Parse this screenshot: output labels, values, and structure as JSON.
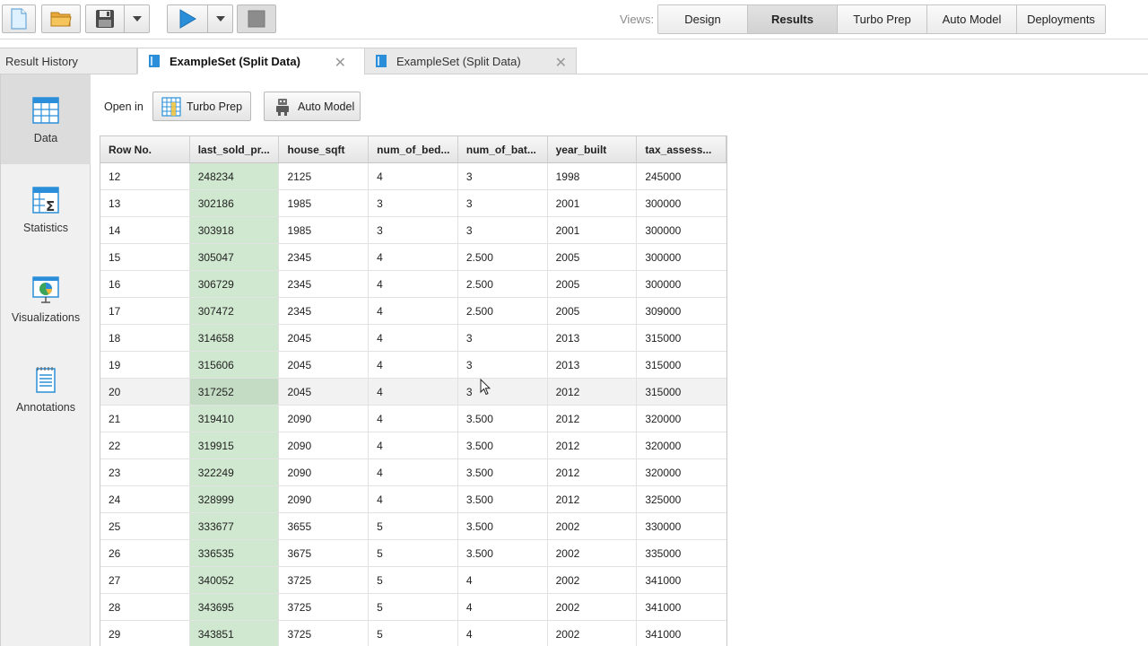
{
  "toolbar": {
    "views_label": "Views:",
    "views": [
      {
        "label": "Design",
        "active": false
      },
      {
        "label": "Results",
        "active": true
      },
      {
        "label": "Turbo Prep",
        "active": false
      },
      {
        "label": "Auto Model",
        "active": false
      },
      {
        "label": "Deployments",
        "active": false
      }
    ]
  },
  "tabs": {
    "history_label": "Result History",
    "items": [
      {
        "label": "ExampleSet (Split Data)",
        "active": true
      },
      {
        "label": "ExampleSet (Split Data)",
        "active": false
      }
    ]
  },
  "sidebar": {
    "items": [
      {
        "label": "Data",
        "icon": "data-table-icon",
        "active": true
      },
      {
        "label": "Statistics",
        "icon": "statistics-icon",
        "active": false
      },
      {
        "label": "Visualizations",
        "icon": "visualizations-icon",
        "active": false
      },
      {
        "label": "Annotations",
        "icon": "annotations-icon",
        "active": false
      }
    ]
  },
  "open_in": {
    "label": "Open in",
    "turbo_prep": "Turbo Prep",
    "auto_model": "Auto Model"
  },
  "table": {
    "columns": [
      "Row No.",
      "last_sold_pr...",
      "house_sqft",
      "num_of_bed...",
      "num_of_bat...",
      "year_built",
      "tax_assess..."
    ],
    "rows": [
      [
        "12",
        "248234",
        "2125",
        "4",
        "3",
        "1998",
        "245000"
      ],
      [
        "13",
        "302186",
        "1985",
        "3",
        "3",
        "2001",
        "300000"
      ],
      [
        "14",
        "303918",
        "1985",
        "3",
        "3",
        "2001",
        "300000"
      ],
      [
        "15",
        "305047",
        "2345",
        "4",
        "2.500",
        "2005",
        "300000"
      ],
      [
        "16",
        "306729",
        "2345",
        "4",
        "2.500",
        "2005",
        "300000"
      ],
      [
        "17",
        "307472",
        "2345",
        "4",
        "2.500",
        "2005",
        "309000"
      ],
      [
        "18",
        "314658",
        "2045",
        "4",
        "3",
        "2013",
        "315000"
      ],
      [
        "19",
        "315606",
        "2045",
        "4",
        "3",
        "2013",
        "315000"
      ],
      [
        "20",
        "317252",
        "2045",
        "4",
        "3",
        "2012",
        "315000"
      ],
      [
        "21",
        "319410",
        "2090",
        "4",
        "3.500",
        "2012",
        "320000"
      ],
      [
        "22",
        "319915",
        "2090",
        "4",
        "3.500",
        "2012",
        "320000"
      ],
      [
        "23",
        "322249",
        "2090",
        "4",
        "3.500",
        "2012",
        "320000"
      ],
      [
        "24",
        "328999",
        "2090",
        "4",
        "3.500",
        "2012",
        "325000"
      ],
      [
        "25",
        "333677",
        "3655",
        "5",
        "3.500",
        "2002",
        "330000"
      ],
      [
        "26",
        "336535",
        "3675",
        "5",
        "3.500",
        "2002",
        "335000"
      ],
      [
        "27",
        "340052",
        "3725",
        "5",
        "4",
        "2002",
        "341000"
      ],
      [
        "28",
        "343695",
        "3725",
        "5",
        "4",
        "2002",
        "341000"
      ],
      [
        "29",
        "343851",
        "3725",
        "5",
        "4",
        "2002",
        "341000"
      ]
    ]
  },
  "colors": {
    "label_column": "#cfe8cf",
    "accent_blue": "#2a8fd8"
  }
}
